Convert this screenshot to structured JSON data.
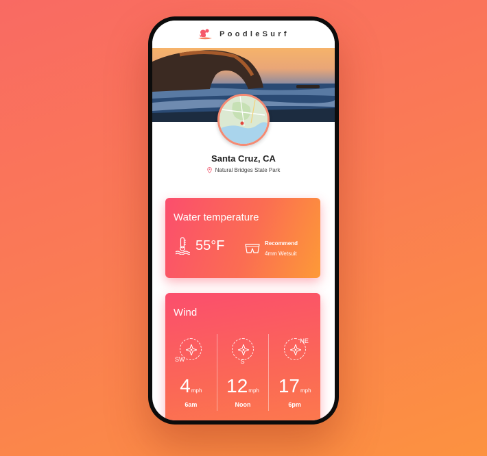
{
  "app": {
    "brand": "PoodleSurf",
    "logo_icon": "poodle-surfer-icon"
  },
  "location": {
    "city": "Santa Cruz, CA",
    "spot": "Natural Bridges State Park",
    "pin_icon": "location-pin-icon"
  },
  "water": {
    "title": "Water temperature",
    "temperature": "55°F",
    "icon": "thermometer-water-icon",
    "recommend_label": "Recommend",
    "recommend_value": "4mm Wetsuit",
    "recommend_icon": "swim-shorts-icon"
  },
  "wind": {
    "title": "Wind",
    "unit": "mph",
    "readings": [
      {
        "direction": "SW",
        "speed": "4",
        "time": "6am"
      },
      {
        "direction": "S",
        "speed": "12",
        "time": "Noon"
      },
      {
        "direction": "NE",
        "speed": "17",
        "time": "6pm"
      }
    ]
  },
  "colors": {
    "accent_start": "#fb4e6d",
    "accent_end": "#fd9a37",
    "map_border": "#f58a73"
  }
}
